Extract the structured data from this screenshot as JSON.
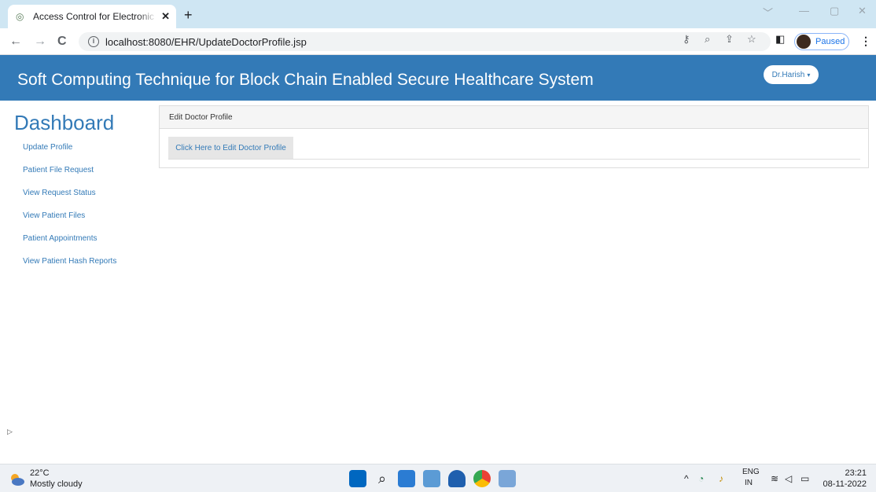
{
  "browser": {
    "tab_title": "Access Control for Electronic Hea",
    "tab_close": "✕",
    "new_tab": "+",
    "url": "localhost:8080/EHR/UpdateDoctorProfile.jsp",
    "profile_status": "Paused",
    "window_controls": [
      "﹀",
      "—",
      "▢",
      "✕"
    ]
  },
  "header": {
    "site_title": "Soft Computing Technique for Block Chain Enabled Secure Healthcare System",
    "user_menu": "Dr.Harish",
    "user_caret": "▾"
  },
  "sidebar": {
    "title": "Dashboard",
    "items": [
      {
        "label": "Update Profile"
      },
      {
        "label": "Patient File Request"
      },
      {
        "label": "View Request Status"
      },
      {
        "label": "View Patient Files"
      },
      {
        "label": "Patient Appointments"
      },
      {
        "label": "View Patient Hash Reports"
      }
    ]
  },
  "panel": {
    "heading": "Edit Doctor Profile",
    "button_label": "Click Here to Edit Doctor Profile"
  },
  "marker": "▷",
  "taskbar": {
    "temperature": "22°C",
    "weather": "Mostly cloudy",
    "lang_top": "ENG",
    "lang_bottom": "IN",
    "time": "23:21",
    "date": "08-11-2022"
  },
  "colors": {
    "header_bg": "#337ab7",
    "link": "#337ab7",
    "tabstrip_bg": "#cfe6f3"
  }
}
